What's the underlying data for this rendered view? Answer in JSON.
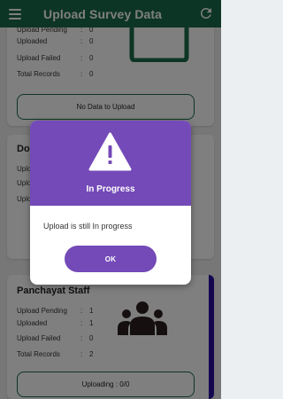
{
  "appbar": {
    "title": "Upload Survey Data",
    "menu_icon": "menu-icon",
    "refresh_icon": "refresh-icon",
    "color": "#1b6b4b"
  },
  "cards": [
    {
      "title": "",
      "rows": [
        {
          "label": "Upload Pending",
          "value": "0"
        },
        {
          "label": "Uploaded",
          "value": "0"
        },
        {
          "label": "Upload Failed",
          "value": "0"
        },
        {
          "label": "Total Records",
          "value": "0"
        }
      ],
      "button": "No Data to Upload"
    },
    {
      "title": "Do",
      "rows": [
        {
          "label": "Uplo",
          "value": ""
        },
        {
          "label": "Uplo",
          "value": ""
        },
        {
          "label": "Uplo",
          "value": ""
        }
      ]
    },
    {
      "title": "Panchayat Staff",
      "rows": [
        {
          "label": "Upload Pending",
          "value": "1"
        },
        {
          "label": "Uploaded",
          "value": "1"
        },
        {
          "label": "Upload Failed",
          "value": "0"
        },
        {
          "label": "Total Records",
          "value": "2"
        }
      ],
      "button": "Uploading : 0/0",
      "accent": "#2a0f9e"
    }
  ],
  "separator": ":",
  "dialog": {
    "icon": "warning-icon",
    "title": "In Progress",
    "message": "Upload is still In progress",
    "ok_label": "OK",
    "color": "#7449b8"
  }
}
